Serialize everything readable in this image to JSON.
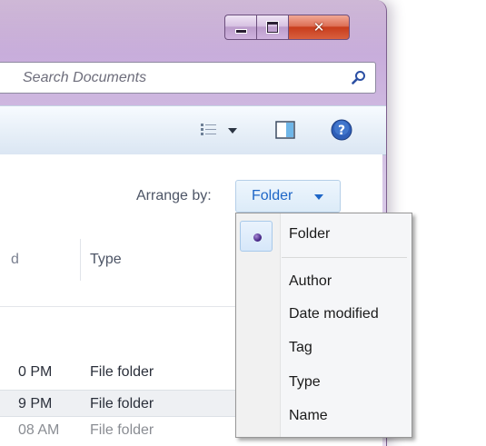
{
  "window": {
    "caption_buttons": {
      "minimize_icon": "minimize-icon",
      "maximize_icon": "maximize-icon",
      "close_glyph": "✕"
    }
  },
  "search": {
    "placeholder": "Search Documents",
    "icon": "search-icon"
  },
  "toolbar": {
    "icons": [
      "view-options-icon",
      "dropdown-caret-icon",
      "preview-pane-icon",
      "help-icon"
    ]
  },
  "content": {
    "arrange_label": "Arrange by:",
    "arrange_value": "Folder",
    "columns": {
      "partial": "d",
      "type": "Type"
    },
    "rows": [
      {
        "date": "0 PM",
        "type": "File folder"
      },
      {
        "date": "9 PM",
        "type": "File folder"
      },
      {
        "date": "08 AM",
        "type": "File folder"
      }
    ]
  },
  "arrange_menu": {
    "selected": "Folder",
    "items": [
      "Folder",
      "Author",
      "Date modified",
      "Tag",
      "Type",
      "Name"
    ]
  },
  "colors": {
    "accent_link": "#1e66c7",
    "frame": "#c8addb",
    "close_button": "#c83c1c"
  }
}
